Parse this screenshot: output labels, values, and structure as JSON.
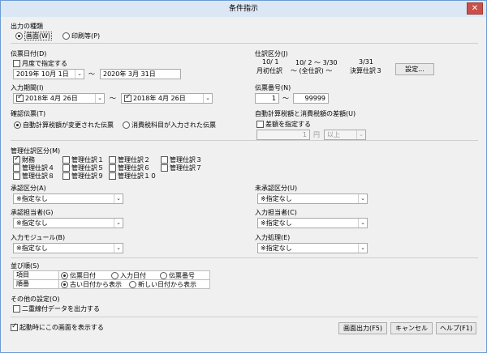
{
  "window": {
    "title": "条件指示",
    "close": "✕"
  },
  "output_type": {
    "title": "出力の種類",
    "options": [
      "画面(W)",
      "印刷等(P)"
    ]
  },
  "slip_date": {
    "title": "伝票日付(D)",
    "month_check": "月度で指定する",
    "from": "2019年 10月  1日",
    "tilde": "〜",
    "to": "2020年  3月 31日"
  },
  "journal_category": {
    "title": "仕訳区分(J)",
    "row1": [
      "10/ 1",
      "10/ 2 〜  3/30",
      "3/31"
    ],
    "row2": [
      "月初仕訳",
      "〜 (全仕訳) 〜",
      "決算仕訳３"
    ],
    "settings": "設定..."
  },
  "input_period": {
    "title": "入力期間(I)",
    "from": "2018年  4月 26日",
    "tilde": "〜",
    "to": "2018年  4月 26日"
  },
  "slip_number": {
    "title": "伝票番号(N)",
    "from": "1",
    "tilde": "〜",
    "to": "99999"
  },
  "confirm_slip": {
    "title": "確認伝票(T)",
    "options": [
      "自動計算税額が変更された伝票",
      "消費税科目が入力された伝票"
    ]
  },
  "tax_diff": {
    "title": "自動計算税額と消費税額の差額(U)",
    "check": "差額を指定する",
    "amount": "1",
    "unit": "円",
    "cond": "以上"
  },
  "mgmt_category": {
    "title": "管理仕訳区分(M)",
    "items": [
      "財務",
      "管理仕訳１",
      "管理仕訳２",
      "管理仕訳３",
      "管理仕訳４",
      "管理仕訳５",
      "管理仕訳６",
      "管理仕訳７",
      "管理仕訳８",
      "管理仕訳９",
      "管理仕訳１０"
    ]
  },
  "approval": {
    "title": "承認区分(A)",
    "value": "※指定なし"
  },
  "unapproved": {
    "title": "未承認区分(U)",
    "value": "※指定なし"
  },
  "approver": {
    "title": "承認担当者(G)",
    "value": "※指定なし"
  },
  "input_person": {
    "title": "入力担当者(C)",
    "value": "※指定なし"
  },
  "input_module": {
    "title": "入力モジュール(B)",
    "value": "※指定なし"
  },
  "input_process": {
    "title": "入力処理(E)",
    "value": "※指定なし"
  },
  "sort": {
    "title": "並び順(S)",
    "row1_label": "項目",
    "row1_options": [
      "伝票日付",
      "入力日付",
      "伝票番号"
    ],
    "row2_label": "順番",
    "row2_options": [
      "古い日付から表示",
      "新しい日付から表示"
    ]
  },
  "other": {
    "title": "その他の設定(O)",
    "check": "二重線付データを出力する"
  },
  "startup_check": "起動時にこの画面を表示する",
  "buttons": {
    "screen_output": "画面出力(F5)",
    "cancel": "キャンセル",
    "help": "ヘルプ(F1)"
  },
  "icons": {
    "dropdown": "⌄"
  }
}
